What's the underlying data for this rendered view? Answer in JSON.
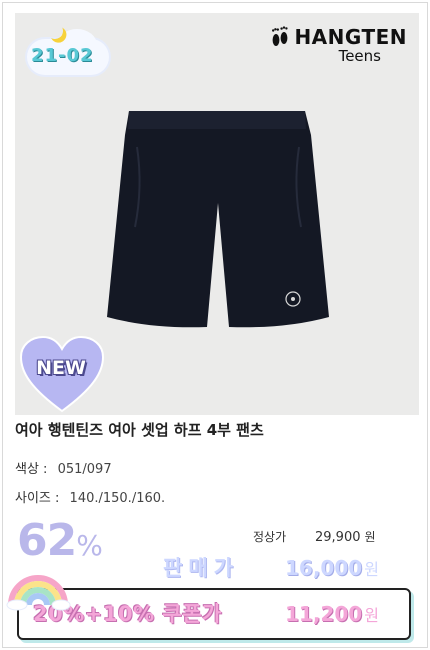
{
  "season_badge": "21-02",
  "brand": {
    "name": "HANGTEN",
    "sub": "Teens"
  },
  "new_badge": "NEW",
  "product": {
    "title": "여아 행텐틴즈 여아 셋업 하프 4부 팬츠",
    "color_label": "색상 :",
    "color_value": "051/097",
    "size_label": "사이즈 :",
    "size_value": "140./150./160."
  },
  "pricing": {
    "discount_value": "62",
    "discount_unit": "%",
    "regular_label": "정상가",
    "regular_price": "29,900",
    "regular_currency": "원",
    "sale_label": "판매가",
    "sale_price": "16,000",
    "sale_currency": "원",
    "coupon_label": "20%+10% 쿠폰가",
    "coupon_price": "11,200",
    "coupon_currency": "원"
  },
  "colors": {
    "accent_lavender": "#b9b7ea",
    "coupon_pink": "#f4a6d8",
    "photo_bg": "#ebebea",
    "product_navy": "#141824"
  }
}
